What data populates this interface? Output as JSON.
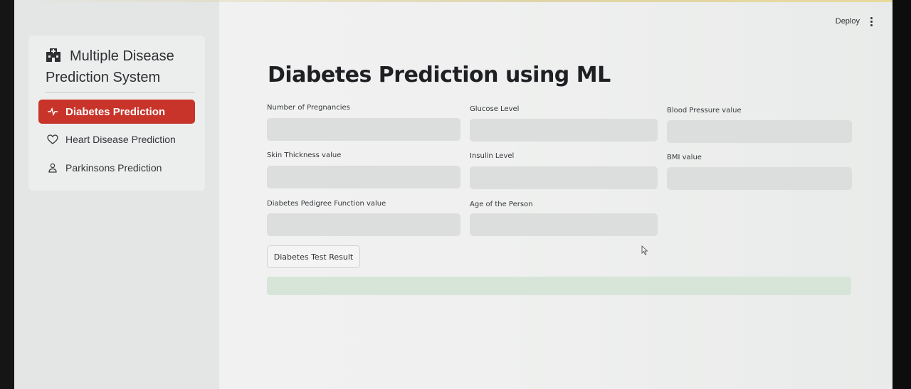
{
  "sidebar": {
    "app_title": "Multiple Disease Prediction System",
    "items": [
      {
        "label": "Diabetes Prediction",
        "icon": "activity-icon",
        "active": true
      },
      {
        "label": "Heart Disease Prediction",
        "icon": "heart-icon",
        "active": false
      },
      {
        "label": "Parkinsons Prediction",
        "icon": "person-icon",
        "active": false
      }
    ]
  },
  "header": {
    "deploy_label": "Deploy",
    "menu_icon": "kebab-menu-icon"
  },
  "main": {
    "title": "Diabetes Prediction using ML",
    "fields": [
      {
        "label": "Number of Pregnancies",
        "value": ""
      },
      {
        "label": "Glucose Level",
        "value": ""
      },
      {
        "label": "Blood Pressure value",
        "value": ""
      },
      {
        "label": "Skin Thickness value",
        "value": ""
      },
      {
        "label": "Insulin Level",
        "value": ""
      },
      {
        "label": "BMI value",
        "value": ""
      },
      {
        "label": "Diabetes Pedigree Function value",
        "value": ""
      },
      {
        "label": "Age of the Person",
        "value": ""
      }
    ],
    "submit_label": "Diabetes Test Result",
    "result_text": ""
  },
  "colors": {
    "accent": "#c8342a",
    "input_bg": "#dcdedd",
    "result_bg": "#d6e5d8"
  }
}
